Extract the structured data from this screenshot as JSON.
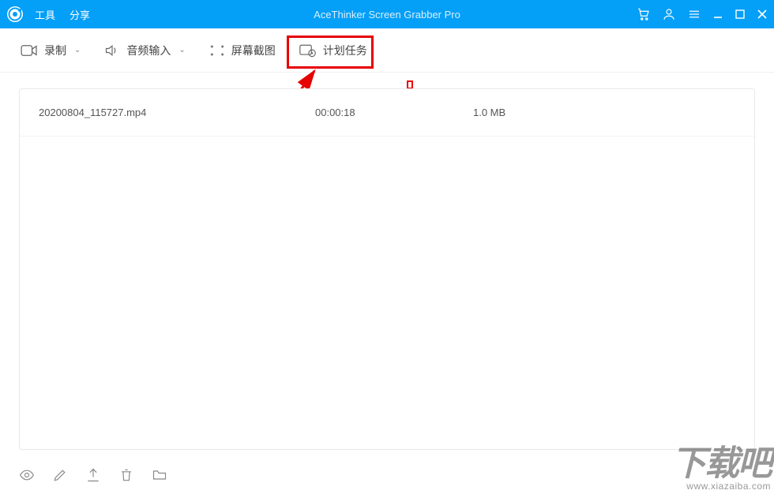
{
  "titlebar": {
    "app_title": "AceThinker Screen Grabber Pro",
    "menu": {
      "tools": "工具",
      "share": "分享"
    }
  },
  "toolbar": {
    "record": "录制",
    "audio_input": "音频输入",
    "screenshot": "屏幕截图",
    "scheduled_task": "计划任务"
  },
  "recordings": [
    {
      "name": "20200804_115727.mp4",
      "duration": "00:00:18",
      "size": "1.0 MB"
    }
  ],
  "watermark": {
    "line1": "下载吧",
    "line2": "www.xiazaiba.com"
  }
}
